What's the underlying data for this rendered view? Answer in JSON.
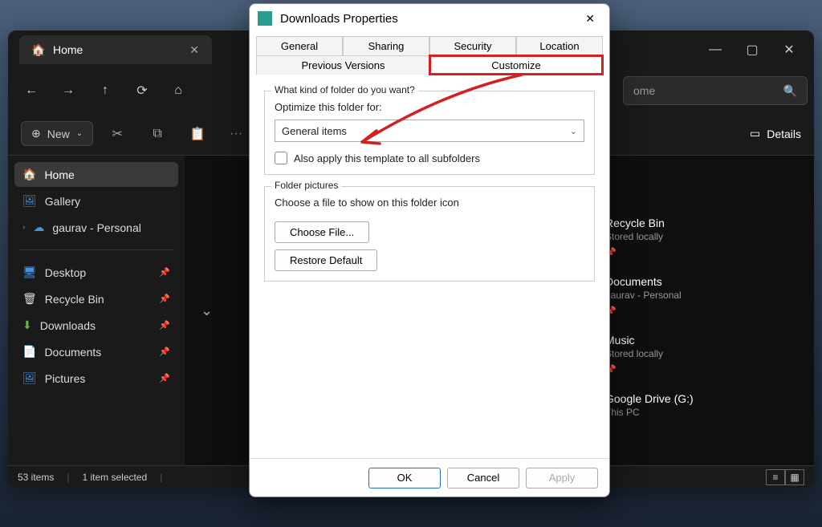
{
  "explorer": {
    "tab_title": "Home",
    "search_placeholder": "ome",
    "new_label": "New",
    "details_label": "Details",
    "dots": "···",
    "sidebar": [
      {
        "label": "Home",
        "icon": "🏠",
        "active": true
      },
      {
        "label": "Gallery",
        "icon": "🖼"
      },
      {
        "label": "gaurav - Personal",
        "icon": "☁",
        "expandable": true
      }
    ],
    "quick": [
      {
        "label": "Desktop",
        "icon": "🖥"
      },
      {
        "label": "Recycle Bin",
        "icon": "🗑"
      },
      {
        "label": "Downloads",
        "icon": "⬇"
      },
      {
        "label": "Documents",
        "icon": "📄"
      },
      {
        "label": "Pictures",
        "icon": "🖼"
      }
    ],
    "right_items": [
      {
        "title": "Recycle Bin",
        "sub": "Stored locally"
      },
      {
        "title": "Documents",
        "sub": "gaurav - Personal"
      },
      {
        "title": "Music",
        "sub": "Stored locally"
      },
      {
        "title": "Google Drive (G:)",
        "sub": "This PC"
      }
    ],
    "status_count": "53 items",
    "status_selected": "1 item selected"
  },
  "dialog": {
    "title": "Downloads Properties",
    "tabs_row1": [
      "General",
      "Sharing",
      "Security",
      "Location"
    ],
    "tabs_row2": [
      "Previous Versions",
      "Customize"
    ],
    "group1_title": "What kind of folder do you want?",
    "optimize_label": "Optimize this folder for:",
    "optimize_value": "General items",
    "subfolders_label": "Also apply this template to all subfolders",
    "group2_title": "Folder pictures",
    "group2_desc": "Choose a file to show on this folder icon",
    "choose_file": "Choose File...",
    "restore_default": "Restore Default",
    "ok": "OK",
    "cancel": "Cancel",
    "apply": "Apply"
  }
}
